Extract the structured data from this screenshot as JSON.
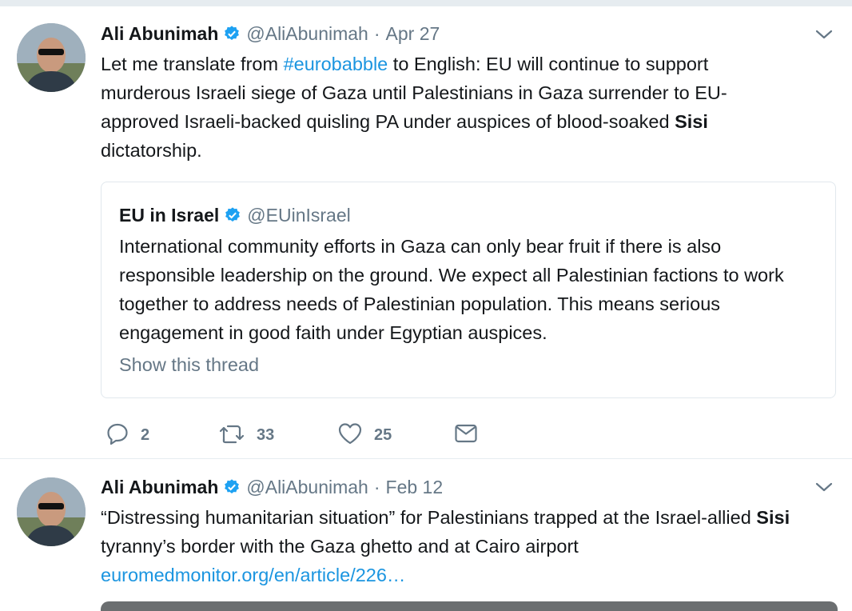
{
  "tweets": [
    {
      "name": "Ali Abunimah",
      "handle": "@AliAbunimah",
      "separator": "·",
      "date": "Apr 27",
      "text": {
        "p1": "Let me translate from ",
        "hashtag": "#eurobabble",
        "p2": " to English: EU will continue to support murderous Israeli siege of Gaza until Palestinians in Gaza surrender to EU-approved Israeli-backed quisling PA under auspices of blood-soaked ",
        "bold": "Sisi",
        "p3": " dictatorship."
      },
      "quote": {
        "name": "EU in Israel",
        "handle": "@EUinIsrael",
        "text": "International community efforts in Gaza can only bear fruit if there is also responsible leadership on the ground. We expect all Palestinian factions to work together to address needs of Palestinian population. This means serious engagement in good faith under Egyptian auspices.",
        "show_thread": "Show this thread"
      },
      "actions": {
        "replies": "2",
        "retweets": "33",
        "likes": "25"
      }
    },
    {
      "name": "Ali Abunimah",
      "handle": "@AliAbunimah",
      "separator": "·",
      "date": "Feb 12",
      "text": {
        "p1": "“Distressing humanitarian situation” for Palestinians trapped at the Israel-allied ",
        "bold": "Sisi",
        "p2": " tyranny’s border with the Gaza ghetto and at Cairo airport ",
        "link": "euromedmonitor.org/en/article/226…"
      }
    }
  ],
  "colors": {
    "accent": "#1b95e0",
    "muted": "#657786",
    "text": "#14171a",
    "border": "#e1e8ed"
  },
  "icons": [
    "verified-badge-icon",
    "chevron-down-icon",
    "reply-icon",
    "retweet-icon",
    "like-icon",
    "direct-message-icon"
  ]
}
